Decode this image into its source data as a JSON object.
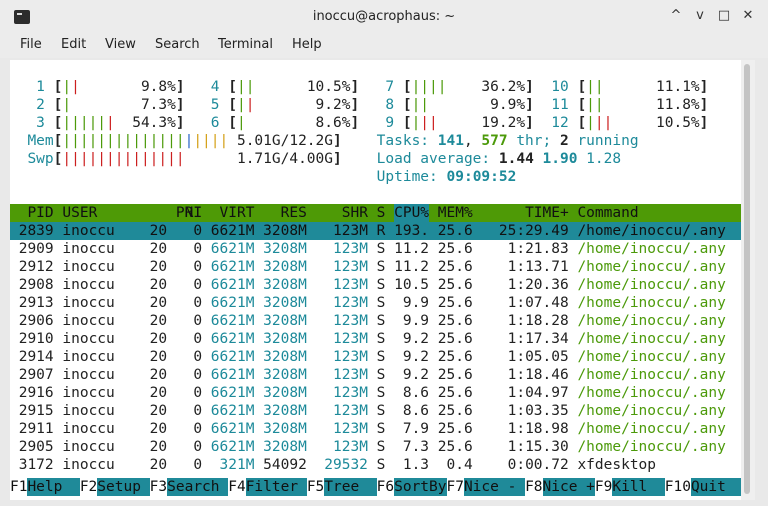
{
  "window": {
    "title": "inoccu@acrophaus: ~",
    "minimize": "^",
    "restore": "v",
    "maximize": "□",
    "close": "✕"
  },
  "menu": [
    "File",
    "Edit",
    "View",
    "Search",
    "Terminal",
    "Help"
  ],
  "cpu": [
    {
      "label": "1",
      "val": "9.8%"
    },
    {
      "label": "2",
      "val": "7.3%"
    },
    {
      "label": "3",
      "val": "54.3%"
    },
    {
      "label": "4",
      "val": "10.5%"
    },
    {
      "label": "5",
      "val": "9.2%"
    },
    {
      "label": "6",
      "val": "8.6%"
    },
    {
      "label": "7",
      "val": "36.2%"
    },
    {
      "label": "8",
      "val": "9.9%"
    },
    {
      "label": "9",
      "val": "19.2%"
    },
    {
      "label": "10",
      "val": "11.1%"
    },
    {
      "label": "11",
      "val": "11.8%"
    },
    {
      "label": "12",
      "val": "10.5%"
    }
  ],
  "mem": {
    "label": "Mem",
    "val": "5.01G/12.2G"
  },
  "swp": {
    "label": "Swp",
    "val": "1.71G/4.00G"
  },
  "tasks": {
    "label": "Tasks:",
    "count": "141",
    "thr": "577",
    "thr_label": "thr;",
    "running": "2",
    "running_label": "running"
  },
  "load": {
    "label": "Load average:",
    "v1": "1.44",
    "v5": "1.90",
    "v15": "1.28"
  },
  "uptime": {
    "label": "Uptime:",
    "val": "09:09:52"
  },
  "columns": [
    "PID",
    "USER",
    "PRI",
    "NI",
    "VIRT",
    "RES",
    "SHR",
    "S",
    "CPU%",
    "MEM%",
    "TIME+",
    "Command"
  ],
  "processes": [
    {
      "pid": "2839",
      "user": "inoccu",
      "pri": "20",
      "ni": "0",
      "virt": "6621M",
      "res": "3208M",
      "shr": "123M",
      "s": "R",
      "cpu": "193.",
      "mem": "25.6",
      "time": "25:29.49",
      "cmd": "/home/inoccu/.any"
    },
    {
      "pid": "2909",
      "user": "inoccu",
      "pri": "20",
      "ni": "0",
      "virt": "6621M",
      "res": "3208M",
      "shr": "123M",
      "s": "S",
      "cpu": "11.2",
      "mem": "25.6",
      "time": "1:21.83",
      "cmd": "/home/inoccu/.any"
    },
    {
      "pid": "2912",
      "user": "inoccu",
      "pri": "20",
      "ni": "0",
      "virt": "6621M",
      "res": "3208M",
      "shr": "123M",
      "s": "S",
      "cpu": "11.2",
      "mem": "25.6",
      "time": "1:13.71",
      "cmd": "/home/inoccu/.any"
    },
    {
      "pid": "2908",
      "user": "inoccu",
      "pri": "20",
      "ni": "0",
      "virt": "6621M",
      "res": "3208M",
      "shr": "123M",
      "s": "S",
      "cpu": "10.5",
      "mem": "25.6",
      "time": "1:20.36",
      "cmd": "/home/inoccu/.any"
    },
    {
      "pid": "2913",
      "user": "inoccu",
      "pri": "20",
      "ni": "0",
      "virt": "6621M",
      "res": "3208M",
      "shr": "123M",
      "s": "S",
      "cpu": "9.9",
      "mem": "25.6",
      "time": "1:07.48",
      "cmd": "/home/inoccu/.any"
    },
    {
      "pid": "2906",
      "user": "inoccu",
      "pri": "20",
      "ni": "0",
      "virt": "6621M",
      "res": "3208M",
      "shr": "123M",
      "s": "S",
      "cpu": "9.9",
      "mem": "25.6",
      "time": "1:18.28",
      "cmd": "/home/inoccu/.any"
    },
    {
      "pid": "2910",
      "user": "inoccu",
      "pri": "20",
      "ni": "0",
      "virt": "6621M",
      "res": "3208M",
      "shr": "123M",
      "s": "S",
      "cpu": "9.2",
      "mem": "25.6",
      "time": "1:17.34",
      "cmd": "/home/inoccu/.any"
    },
    {
      "pid": "2914",
      "user": "inoccu",
      "pri": "20",
      "ni": "0",
      "virt": "6621M",
      "res": "3208M",
      "shr": "123M",
      "s": "S",
      "cpu": "9.2",
      "mem": "25.6",
      "time": "1:05.05",
      "cmd": "/home/inoccu/.any"
    },
    {
      "pid": "2907",
      "user": "inoccu",
      "pri": "20",
      "ni": "0",
      "virt": "6621M",
      "res": "3208M",
      "shr": "123M",
      "s": "S",
      "cpu": "9.2",
      "mem": "25.6",
      "time": "1:18.46",
      "cmd": "/home/inoccu/.any"
    },
    {
      "pid": "2916",
      "user": "inoccu",
      "pri": "20",
      "ni": "0",
      "virt": "6621M",
      "res": "3208M",
      "shr": "123M",
      "s": "S",
      "cpu": "8.6",
      "mem": "25.6",
      "time": "1:04.97",
      "cmd": "/home/inoccu/.any"
    },
    {
      "pid": "2915",
      "user": "inoccu",
      "pri": "20",
      "ni": "0",
      "virt": "6621M",
      "res": "3208M",
      "shr": "123M",
      "s": "S",
      "cpu": "8.6",
      "mem": "25.6",
      "time": "1:03.35",
      "cmd": "/home/inoccu/.any"
    },
    {
      "pid": "2911",
      "user": "inoccu",
      "pri": "20",
      "ni": "0",
      "virt": "6621M",
      "res": "3208M",
      "shr": "123M",
      "s": "S",
      "cpu": "7.9",
      "mem": "25.6",
      "time": "1:18.98",
      "cmd": "/home/inoccu/.any"
    },
    {
      "pid": "2905",
      "user": "inoccu",
      "pri": "20",
      "ni": "0",
      "virt": "6621M",
      "res": "3208M",
      "shr": "123M",
      "s": "S",
      "cpu": "7.3",
      "mem": "25.6",
      "time": "1:15.30",
      "cmd": "/home/inoccu/.any"
    },
    {
      "pid": "3172",
      "user": "inoccu",
      "pri": "20",
      "ni": "0",
      "virt": "321M",
      "res": "54092",
      "shr": "29532",
      "s": "S",
      "cpu": "1.3",
      "mem": "0.4",
      "time": "0:00.72",
      "cmd": "xfdesktop"
    }
  ],
  "fkeys": [
    {
      "key": "F1",
      "label": "Help"
    },
    {
      "key": "F2",
      "label": "Setup"
    },
    {
      "key": "F3",
      "label": "Search"
    },
    {
      "key": "F4",
      "label": "Filter"
    },
    {
      "key": "F5",
      "label": "Tree"
    },
    {
      "key": "F6",
      "label": "SortBy"
    },
    {
      "key": "F7",
      "label": "Nice -"
    },
    {
      "key": "F8",
      "label": "Nice +"
    },
    {
      "key": "F9",
      "label": "Kill"
    },
    {
      "key": "F10",
      "label": "Quit"
    }
  ],
  "colors": {
    "header": "#4e9a06",
    "selection": "#1f8a99",
    "accent": "#1d8a9a"
  }
}
